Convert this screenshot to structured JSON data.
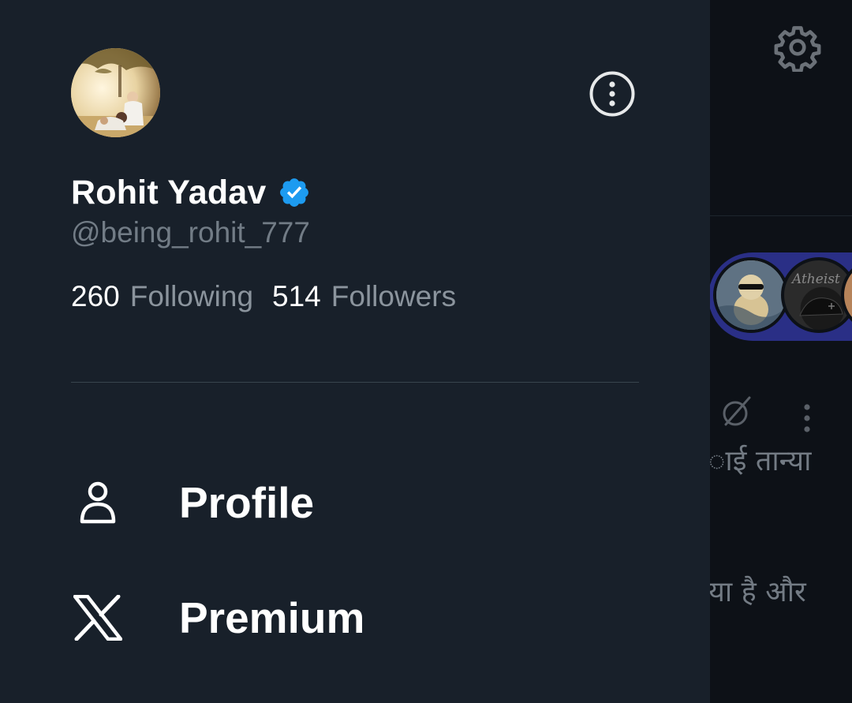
{
  "colors": {
    "drawer_bg": "#18202a",
    "text_primary": "#ffffff",
    "text_secondary": "#727c86",
    "verified_blue": "#1d9bf0",
    "divider": "#38444d",
    "fleet_ring": "#2a2f86"
  },
  "drawer": {
    "avatar_icon": "profile-photo",
    "account_menu_icon": "more-vertical-circle-icon",
    "display_name": "Rohit Yadav",
    "verified_icon": "verified-badge-icon",
    "handle": "@being_rohit_777",
    "stats": {
      "following_count": "260",
      "following_label": "Following",
      "followers_count": "514",
      "followers_label": "Followers"
    },
    "menu": [
      {
        "label": "Profile",
        "icon": "person-icon"
      },
      {
        "label": "Premium",
        "icon": "x-logo-icon"
      }
    ]
  },
  "background": {
    "settings_icon": "gear-icon",
    "fleet_avatar_2_text": "Atheist",
    "post_icons": [
      "no-reply-icon",
      "more-vertical-icon"
    ],
    "post_text_line_1": "ाई तान्या",
    "post_text_line_2": "या है और"
  }
}
